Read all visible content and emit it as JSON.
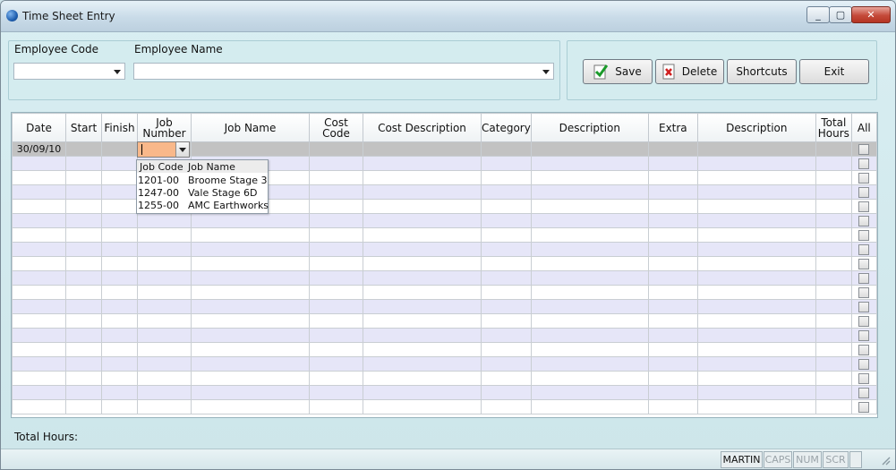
{
  "window": {
    "title": "Time Sheet Entry",
    "min_label": "—",
    "max_label": "▢",
    "close_label": "✕"
  },
  "header": {
    "employee_code_label": "Employee Code",
    "employee_code_value": "",
    "employee_name_label": "Employee Name",
    "employee_name_value": ""
  },
  "toolbar": {
    "save_label": "Save",
    "delete_label": "Delete",
    "shortcuts_label": "Shortcuts",
    "exit_label": "Exit"
  },
  "grid": {
    "columns": [
      "Date",
      "Start",
      "Finish",
      "Job Number",
      "Job Name",
      "Cost Code",
      "Cost Description",
      "Category",
      "Description",
      "Extra",
      "Description",
      "Total Hours",
      "All"
    ],
    "first_row": {
      "date": "30/09/10"
    }
  },
  "job_dropdown": {
    "headers": [
      "Job Code",
      "Job Name"
    ],
    "items": [
      {
        "code": "1201-00",
        "name": "Broome Stage 3"
      },
      {
        "code": "1247-00",
        "name": "Vale Stage 6D"
      },
      {
        "code": "1255-00",
        "name": "AMC Earthworks"
      }
    ]
  },
  "footer": {
    "total_hours_label": "Total Hours:"
  },
  "statusbar": {
    "user": "MARTIN",
    "caps": "CAPS",
    "num": "NUM",
    "scr": "SCR"
  },
  "colors": {
    "row_alt": "#e6e6f8",
    "row_active": "#c2c2c2",
    "job_cell": "#f9b88a",
    "panel": "#d4ecef"
  }
}
